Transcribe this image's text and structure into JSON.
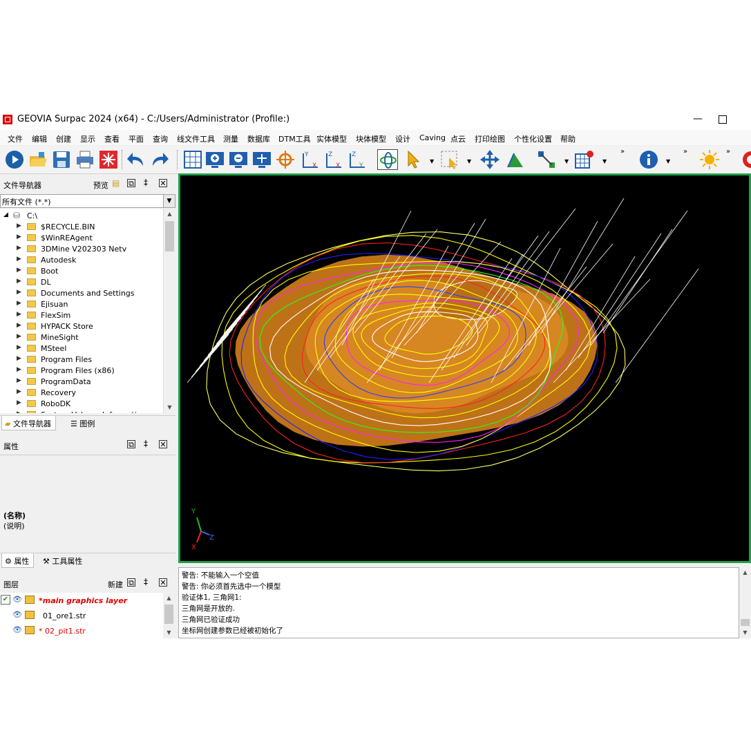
{
  "window": {
    "title": "GEOVIA Surpac 2024 (x64) - C:/Users/Administrator (Profile:)"
  },
  "menu": [
    "文件",
    "编辑",
    "创建",
    "显示",
    "查看",
    "平面",
    "查询",
    "线文件工具",
    "测量",
    "数据库",
    "DTM工具",
    "实体模型",
    "块体模型",
    "设计",
    "Caving",
    "点云",
    "打印绘图",
    "个性化设置",
    "帮助"
  ],
  "navigator": {
    "title": "文件导航器",
    "preview_label": "预览",
    "filter": "所有文件 (*.*)",
    "drive": "C:\\",
    "folders": [
      "$RECYCLE.BIN",
      "$WinREAgent",
      "3DMine V202303 Netv",
      "Autodesk",
      "Boot",
      "DL",
      "Documents and Settings",
      "Ejisuan",
      "FlexSim",
      "HYPACK Store",
      "MineSight",
      "MSteel",
      "Program Files",
      "Program Files (x86)",
      "ProgramData",
      "Recovery",
      "RoboDK",
      "System Volume Information"
    ],
    "tabs": [
      "文件导航器",
      "图例"
    ]
  },
  "properties": {
    "title": "属性",
    "name_label": "(名称)",
    "desc_label": "(说明)",
    "tabs": [
      "属性",
      "工具属性"
    ]
  },
  "layers": {
    "title": "图层",
    "new_label": "新建",
    "items": [
      {
        "name": "*main graphics layer",
        "color": "#e00000",
        "checked": true
      },
      {
        "name": "01_ore1.str",
        "color": "#000000",
        "checked": false
      },
      {
        "name": "* 02_pit1.str",
        "color": "#e00000",
        "checked": false
      }
    ]
  },
  "viewport": {
    "axis_labels": [
      "Y",
      "X",
      "Z"
    ],
    "border_color": "#1fa04a"
  },
  "messages": [
    "警告: 不能输入一个空值",
    "警告: 你必须首先选中一个模型",
    "验证体1, 三角网1:",
    "三角网是开放的.",
    "三角网已验证成功",
    "坐标网创建参数已经被初始化了"
  ]
}
